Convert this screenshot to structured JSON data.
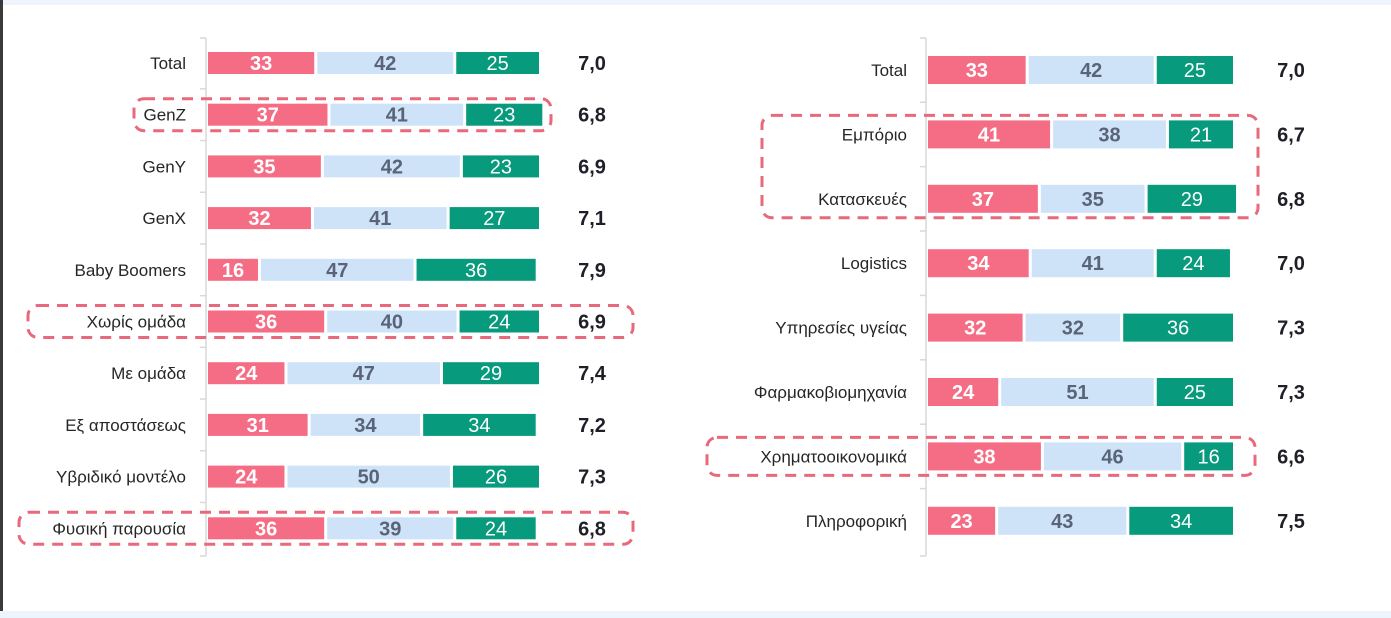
{
  "colors": {
    "negative": "#f56d84",
    "neutral": "#cfe3f8",
    "positive": "#079a7c",
    "highlight": "#e8697c",
    "axis": "#d9d9d9"
  },
  "chart_data": [
    {
      "type": "bar",
      "orientation": "horizontal-stacked-100",
      "title": "",
      "categories": [
        "Total",
        "GenZ",
        "GenY",
        "GenX",
        "Baby Boomers",
        "Χωρίς ομάδα",
        "Με ομάδα",
        "Εξ αποστάσεως",
        "Υβριδικό μοντέλο",
        "Φυσική παρουσία"
      ],
      "series": [
        {
          "name": "negative",
          "values": [
            33,
            37,
            35,
            32,
            16,
            36,
            24,
            31,
            24,
            36
          ]
        },
        {
          "name": "neutral",
          "values": [
            42,
            41,
            42,
            41,
            47,
            40,
            47,
            34,
            50,
            39
          ]
        },
        {
          "name": "positive",
          "values": [
            25,
            23,
            23,
            27,
            36,
            24,
            29,
            34,
            26,
            24
          ]
        }
      ],
      "scores": [
        "7,0",
        "6,8",
        "6,9",
        "7,1",
        "7,9",
        "6,9",
        "7,4",
        "7,2",
        "7,3",
        "6,8"
      ],
      "highlight_groups": [
        [
          "GenZ"
        ],
        [
          "Χωρίς ομάδα"
        ],
        [
          "Φυσική παρουσία"
        ]
      ],
      "xlim": [
        0,
        100
      ],
      "grid": false,
      "legend": "none"
    },
    {
      "type": "bar",
      "orientation": "horizontal-stacked-100",
      "title": "",
      "categories": [
        "Total",
        "Εμπόριο",
        "Κατασκευές",
        "Logistics",
        "Υπηρεσίες υγείας",
        "Φαρμακοβιομηχανία",
        "Χρηματοοικονομικά",
        "Πληροφορική"
      ],
      "series": [
        {
          "name": "negative",
          "values": [
            33,
            41,
            37,
            34,
            32,
            24,
            38,
            23
          ]
        },
        {
          "name": "neutral",
          "values": [
            42,
            38,
            35,
            41,
            32,
            51,
            46,
            43
          ]
        },
        {
          "name": "positive",
          "values": [
            25,
            21,
            29,
            24,
            36,
            25,
            16,
            34
          ]
        }
      ],
      "scores": [
        "7,0",
        "6,7",
        "6,8",
        "7,0",
        "7,3",
        "7,3",
        "6,6",
        "7,5"
      ],
      "highlight_groups": [
        [
          "Εμπόριο",
          "Κατασκευές"
        ],
        [
          "Χρηματοοικονομικά"
        ]
      ],
      "xlim": [
        0,
        100
      ],
      "grid": false,
      "legend": "none"
    }
  ]
}
